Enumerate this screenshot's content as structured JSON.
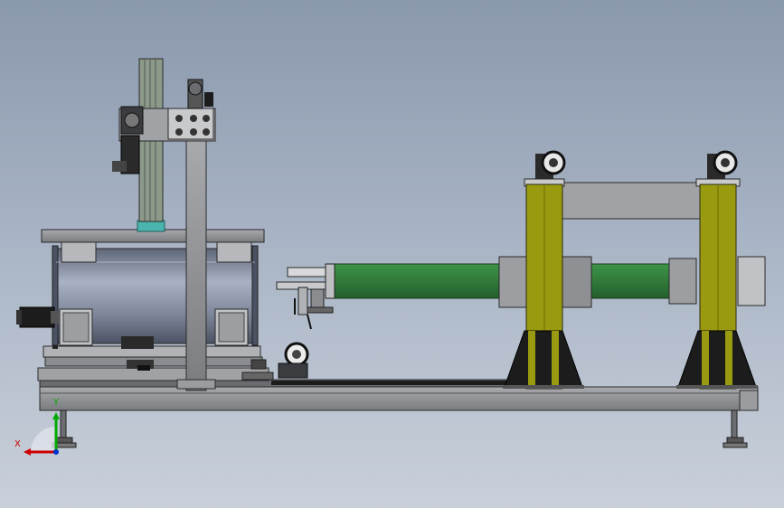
{
  "axes": {
    "x_label": "X",
    "y_label": "Y",
    "x_color": "#cc0000",
    "y_color": "#00aa00"
  },
  "colors": {
    "frame_gray": "#8e9094",
    "dark_steel": "#4a4c50",
    "green_beam": "#2f7d3a",
    "yellow_column": "#9a9a10",
    "black_bracket": "#1c1c1c",
    "drum_blue": "#7f8aa0",
    "teal_screw": "#4bb4ad"
  }
}
